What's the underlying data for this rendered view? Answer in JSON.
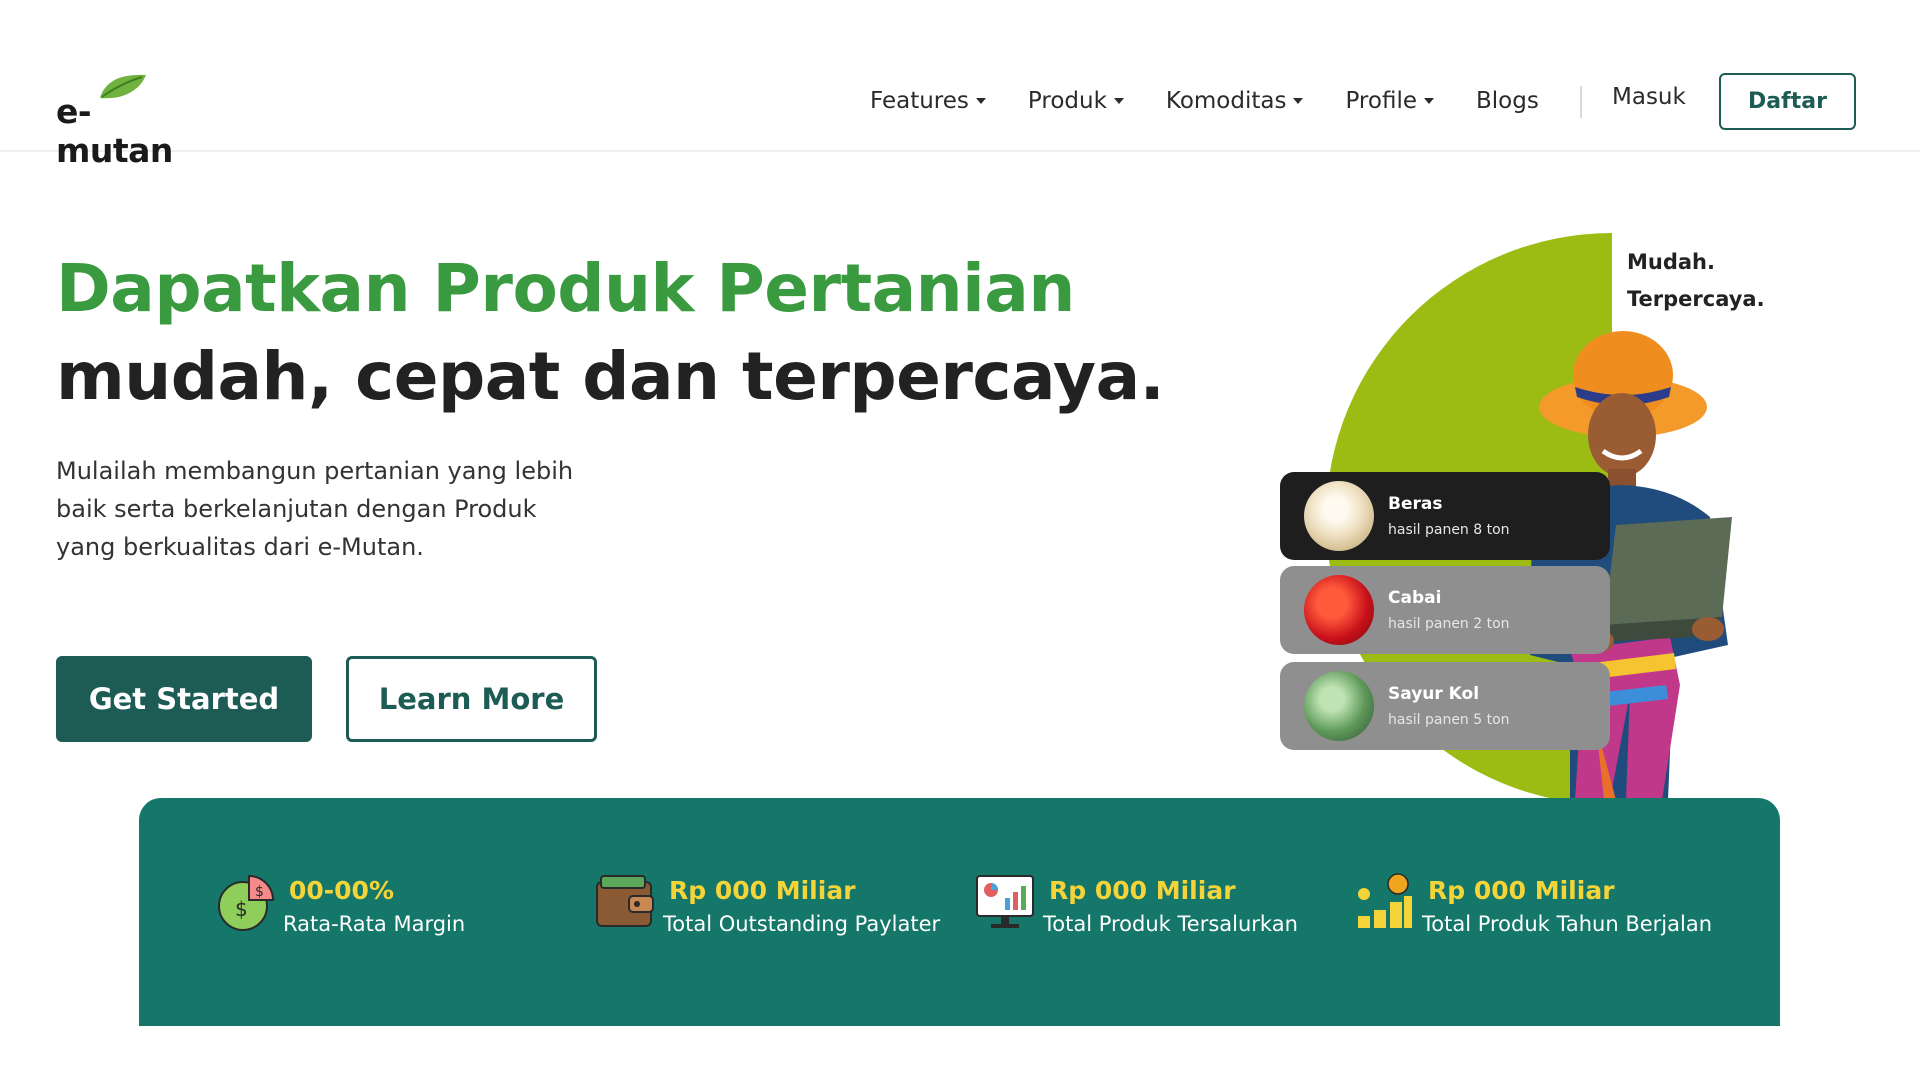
{
  "brand": {
    "logo_text": "e-mutan"
  },
  "nav": {
    "items": [
      {
        "label": "Features",
        "dropdown": true
      },
      {
        "label": "Produk",
        "dropdown": true
      },
      {
        "label": "Komoditas",
        "dropdown": true
      },
      {
        "label": "Profile",
        "dropdown": true
      },
      {
        "label": "Blogs",
        "dropdown": false
      }
    ],
    "login_label": "Masuk",
    "register_label": "Daftar"
  },
  "hero": {
    "title_line1": "Dapatkan Produk Pertanian",
    "title_line2": "mudah, cepat dan terpercaya.",
    "description": "Mulailah membangun pertanian yang lebih baik serta berkelanjutan dengan Produk yang berkualitas dari e-Mutan.",
    "primary_cta": "Get Started",
    "secondary_cta": "Learn More"
  },
  "illustration": {
    "tagline_line1": "Mudah.",
    "tagline_line2": "Terpercaya.",
    "harvests": [
      {
        "name": "Beras",
        "amount": "hasil panen  8 ton"
      },
      {
        "name": "Cabai",
        "amount": "hasil panen  2 ton"
      },
      {
        "name": "Sayur Kol",
        "amount": "hasil panen 5 ton"
      }
    ]
  },
  "stats": [
    {
      "icon": "money-pie-icon",
      "value": "00-00%",
      "label": "Rata-Rata Margin"
    },
    {
      "icon": "wallet-icon",
      "value": "Rp 000 Miliar",
      "label": "Total Outstanding Paylater"
    },
    {
      "icon": "monitor-chart-icon",
      "value": "Rp 000 Miliar",
      "label": "Total Produk Tersalurkan"
    },
    {
      "icon": "coin-stack-growth-icon",
      "value": "Rp 000 Miliar",
      "label": "Total Produk Tahun Berjalan"
    }
  ],
  "colors": {
    "brand_green": "#3a9a3f",
    "dark_teal": "#1d5b55",
    "stats_bg": "#14776a",
    "accent_yellow": "#f5d43a",
    "lime": "#9cbc14"
  }
}
